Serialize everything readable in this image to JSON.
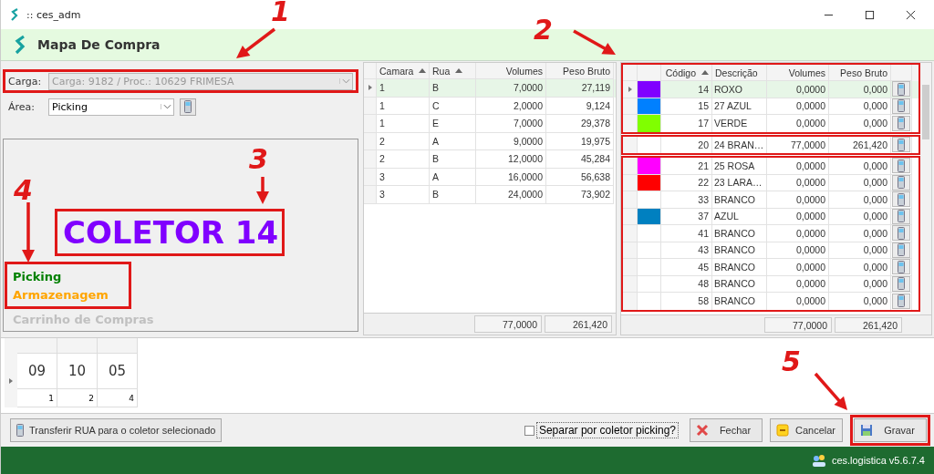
{
  "window": {
    "title": ":: ces_adm"
  },
  "header": {
    "title": "Mapa De Compra"
  },
  "carga": {
    "label": "Carga:",
    "value": "Carga: 9182 / Proc.: 10629  FRIMESA",
    "disabled": true
  },
  "area": {
    "label": "Área:",
    "value": "Picking"
  },
  "coletor": {
    "title": "COLETOR 14",
    "color": "#8000ff"
  },
  "legend": [
    {
      "label": "Picking",
      "color": "#008000"
    },
    {
      "label": "Armazenagem",
      "color": "#ffa500"
    },
    {
      "label": "Carrinho de Compras",
      "color": "#c0c0c0"
    }
  ],
  "ruas": {
    "columns": [
      {
        "label": "Camara",
        "sorted": true
      },
      {
        "label": "Rua",
        "sorted": true
      },
      {
        "label": "Volumes",
        "sorted": false
      },
      {
        "label": "Peso Bruto",
        "sorted": false
      }
    ],
    "rows": [
      {
        "camara": "1",
        "rua": "B",
        "volumes": "7,0000",
        "peso": "27,119",
        "selected": true
      },
      {
        "camara": "1",
        "rua": "C",
        "volumes": "2,0000",
        "peso": "9,124",
        "selected": false
      },
      {
        "camara": "1",
        "rua": "E",
        "volumes": "7,0000",
        "peso": "29,378",
        "selected": false
      },
      {
        "camara": "2",
        "rua": "A",
        "volumes": "9,0000",
        "peso": "19,975",
        "selected": false
      },
      {
        "camara": "2",
        "rua": "B",
        "volumes": "12,0000",
        "peso": "45,284",
        "selected": false
      },
      {
        "camara": "3",
        "rua": "A",
        "volumes": "16,0000",
        "peso": "56,638",
        "selected": false
      },
      {
        "camara": "3",
        "rua": "B",
        "volumes": "24,0000",
        "peso": "73,902",
        "selected": false
      }
    ],
    "totals": {
      "volumes": "77,0000",
      "peso": "261,420"
    }
  },
  "coletores": {
    "columns": [
      {
        "label": "Código",
        "sorted": true
      },
      {
        "label": "Descrição",
        "sorted": false
      },
      {
        "label": "Volumes",
        "sorted": false
      },
      {
        "label": "Peso Bruto",
        "sorted": false
      }
    ],
    "rows": [
      {
        "codigo": "14",
        "descricao": "ROXO",
        "volumes": "0,0000",
        "peso": "0,000",
        "color": "#8000ff",
        "selected": true
      },
      {
        "codigo": "15",
        "descricao": "27 AZUL",
        "volumes": "0,0000",
        "peso": "0,000",
        "color": "#0080ff",
        "selected": false
      },
      {
        "codigo": "17",
        "descricao": "VERDE",
        "volumes": "0,0000",
        "peso": "0,000",
        "color": "#80ff00",
        "selected": false
      },
      {
        "codigo": "20",
        "descricao": "24 BRAN…",
        "volumes": "77,0000",
        "peso": "261,420",
        "selected": false
      },
      {
        "codigo": "21",
        "descricao": "25 ROSA",
        "volumes": "0,0000",
        "peso": "0,000",
        "color": "#ff00ff",
        "selected": false
      },
      {
        "codigo": "22",
        "descricao": "23 LARA…",
        "volumes": "0,0000",
        "peso": "0,000",
        "color": "#ff0000",
        "selected": false
      },
      {
        "codigo": "33",
        "descricao": "BRANCO",
        "volumes": "0,0000",
        "peso": "0,000",
        "selected": false
      },
      {
        "codigo": "37",
        "descricao": "AZUL",
        "volumes": "0,0000",
        "peso": "0,000",
        "color": "#0080c0",
        "selected": false
      },
      {
        "codigo": "41",
        "descricao": "BRANCO",
        "volumes": "0,0000",
        "peso": "0,000",
        "selected": false
      },
      {
        "codigo": "43",
        "descricao": "BRANCO",
        "volumes": "0,0000",
        "peso": "0,000",
        "selected": false
      },
      {
        "codigo": "45",
        "descricao": "BRANCO",
        "volumes": "0,0000",
        "peso": "0,000",
        "selected": false
      },
      {
        "codigo": "48",
        "descricao": "BRANCO",
        "volumes": "0,0000",
        "peso": "0,000",
        "selected": false
      },
      {
        "codigo": "58",
        "descricao": "BRANCO",
        "volumes": "0,0000",
        "peso": "0,000",
        "selected": false
      }
    ],
    "totals": {
      "volumes": "77,0000",
      "peso": "261,420"
    }
  },
  "distribution": {
    "selected": true,
    "cells": [
      {
        "value": "09",
        "count": "1"
      },
      {
        "value": "10",
        "count": "2"
      },
      {
        "value": "05",
        "count": "4"
      }
    ]
  },
  "toolbar": {
    "transfer": "Transferir RUA para o coletor selecionado",
    "separate": {
      "label": "Separar por coletor picking?",
      "checked": false
    },
    "buttons": [
      {
        "kind": "close",
        "label": "Fechar"
      },
      {
        "kind": "cancel",
        "label": "Cancelar"
      },
      {
        "kind": "save",
        "label": "Gravar"
      }
    ]
  },
  "status_bar": {
    "version": "ces.logistica v5.6.7.4"
  },
  "annotations": [
    {
      "label": "1"
    },
    {
      "label": "2"
    },
    {
      "label": "3"
    },
    {
      "label": "4"
    },
    {
      "label": "5"
    }
  ]
}
